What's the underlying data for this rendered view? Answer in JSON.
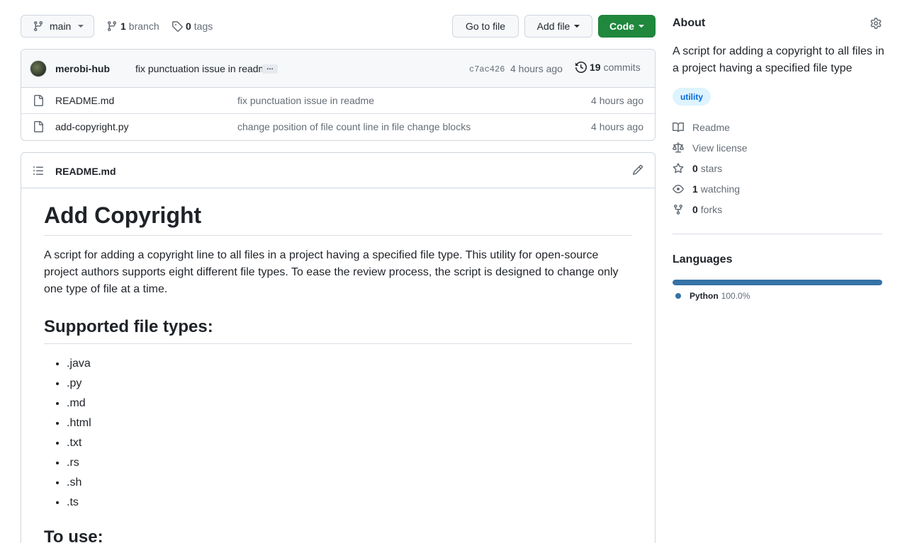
{
  "toolbar": {
    "branch_name": "main",
    "branches_count": "1",
    "branches_label": "branch",
    "tags_count": "0",
    "tags_label": "tags",
    "go_to_file": "Go to file",
    "add_file": "Add file",
    "code": "Code"
  },
  "latest_commit": {
    "author": "merobi-hub",
    "message": "fix punctuation issue in readme",
    "ellipsis": "…",
    "sha": "c7ac426",
    "time": "4 hours ago",
    "commits_count": "19",
    "commits_label": "commits"
  },
  "files": [
    {
      "name": "README.md",
      "message": "fix punctuation issue in readme",
      "time": "4 hours ago",
      "icon": "file-icon"
    },
    {
      "name": "add-copyright.py",
      "message": "change position of file count line in file change blocks",
      "time": "4 hours ago",
      "icon": "file-icon"
    }
  ],
  "readme": {
    "filename": "README.md",
    "title": "Add Copyright",
    "intro": "A script for adding a copyright line to all files in a project having a specified file type. This utility for open-source project authors supports eight different file types. To ease the review process, the script is designed to change only one type of file at a time.",
    "supported_heading": "Supported file types:",
    "file_types": [
      ".java",
      ".py",
      ".md",
      ".html",
      ".txt",
      ".rs",
      ".sh",
      ".ts"
    ],
    "usage_heading": "To use:"
  },
  "about": {
    "title": "About",
    "description": "A script for adding a copyright to all files in a project having a specified file type",
    "topic": "utility",
    "links": {
      "readme": "Readme",
      "license": "View license",
      "stars_count": "0",
      "stars_label": "stars",
      "watching_count": "1",
      "watching_label": "watching",
      "forks_count": "0",
      "forks_label": "forks"
    }
  },
  "languages": {
    "title": "Languages",
    "items": [
      {
        "name": "Python",
        "percent": "100.0%",
        "share": 1.0,
        "color": "#3572A5"
      }
    ]
  },
  "colors": {
    "accent": "#1f883d",
    "link": "#0969da",
    "python": "#3572A5"
  }
}
